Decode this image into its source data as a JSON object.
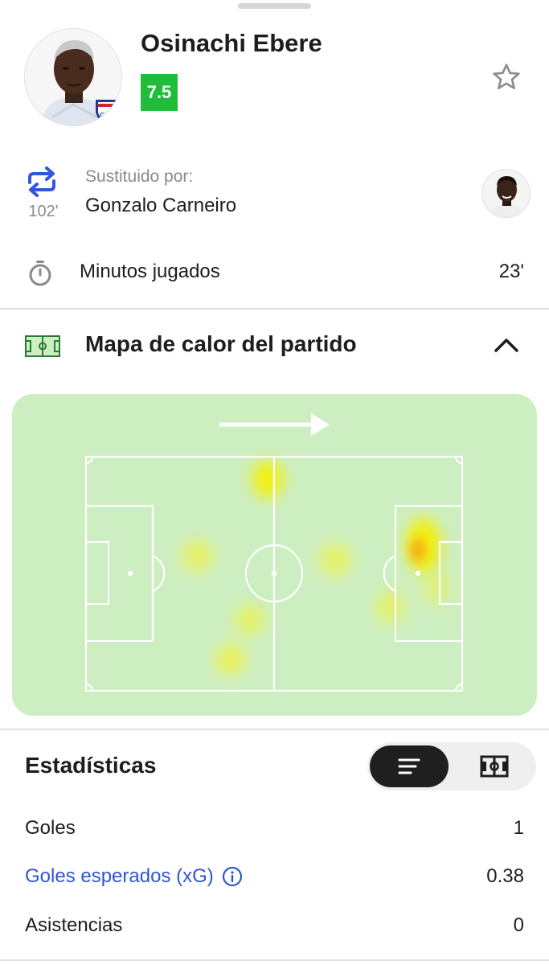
{
  "player": {
    "name": "Osinachi Ebere",
    "rating": "7.5",
    "rating_color": "#1fbd3a",
    "club_badge_text": "C.N.de F."
  },
  "substitution": {
    "caption": "Sustituido por:",
    "player_name": "Gonzalo Carneiro",
    "minute": "102'",
    "icon": "swap-arrows-icon",
    "icon_color": "#3355e0"
  },
  "minutes": {
    "label": "Minutos jugados",
    "value": "23'",
    "icon": "stopwatch-icon"
  },
  "heatmap": {
    "title": "Mapa de calor del partido",
    "icon": "pitch-icon",
    "collapse_icon": "chevron-up-icon",
    "direction": "attacking-right",
    "pitch_color": "#cdeec0"
  },
  "stats": {
    "title": "Estadísticas",
    "view_toggle": {
      "active": "list-icon",
      "inactive": "pitch-view-icon"
    },
    "rows": [
      {
        "label": "Goles",
        "value": "1",
        "is_link": false
      },
      {
        "label": "Goles esperados (xG)",
        "value": "0.38",
        "is_link": true
      },
      {
        "label": "Asistencias",
        "value": "0",
        "is_link": false
      }
    ],
    "link_color": "#2f55d4"
  }
}
